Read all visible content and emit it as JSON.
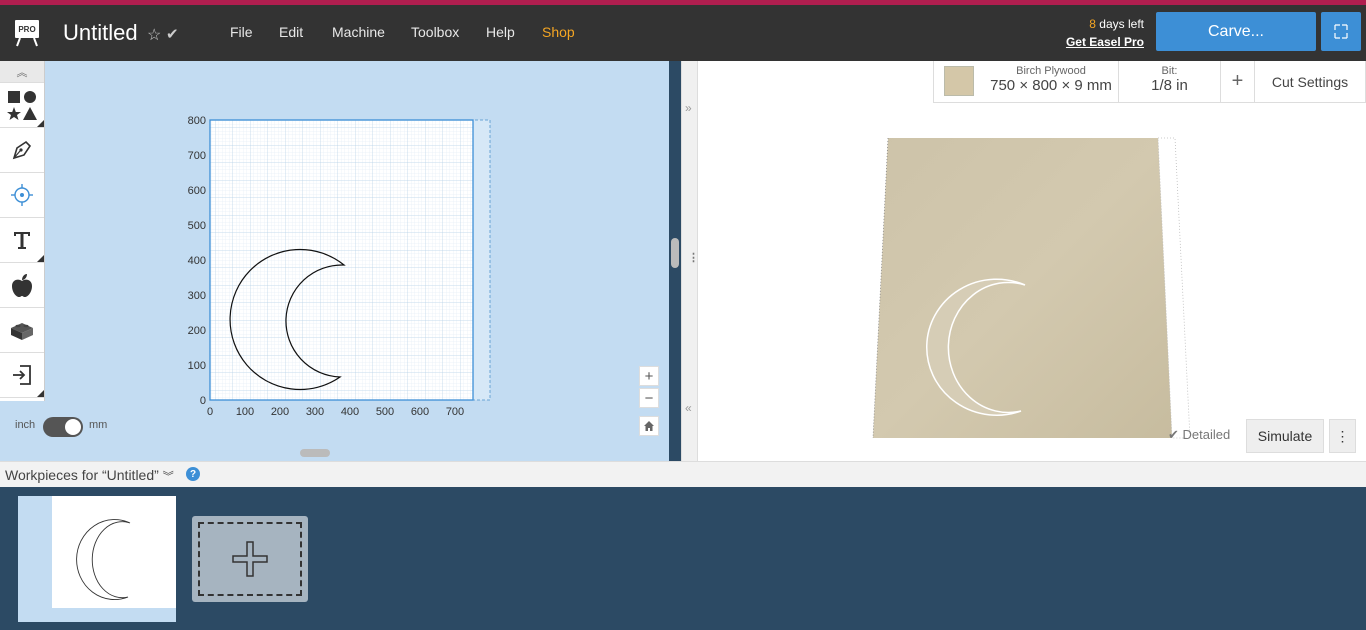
{
  "header": {
    "logo_text": "PRO",
    "title": "Untitled",
    "menu": [
      {
        "label": "File"
      },
      {
        "label": "Edit"
      },
      {
        "label": "Machine"
      },
      {
        "label": "Toolbox"
      },
      {
        "label": "Help"
      },
      {
        "label": "Shop"
      }
    ],
    "days_num": "8",
    "days_suffix": " days left",
    "get_pro": "Get Easel Pro",
    "carve_label": "Carve..."
  },
  "canvas": {
    "y_ticks": [
      "800",
      "700",
      "600",
      "500",
      "400",
      "300",
      "200",
      "100",
      "0"
    ],
    "x_ticks": [
      "0",
      "100",
      "200",
      "300",
      "400",
      "500",
      "600",
      "700"
    ],
    "units_left": "inch",
    "units_right": "mm"
  },
  "material": {
    "name": "Birch Plywood",
    "dimensions": "750 × 800 × 9 mm",
    "bit_label": "Bit:",
    "bit_value": "1/8 in",
    "plus_label": "+",
    "cut_settings": "Cut Settings"
  },
  "preview": {
    "detailed_label": "Detailed",
    "simulate_label": "Simulate",
    "more_label": "⋮"
  },
  "workpieces": {
    "title": "Workpieces for “Untitled”",
    "help": "?"
  },
  "colors": {
    "accent": "#3d8fd6",
    "shop": "#f5a623",
    "topstrip": "#b01e4f",
    "bottom_bg": "#2c4a64"
  }
}
